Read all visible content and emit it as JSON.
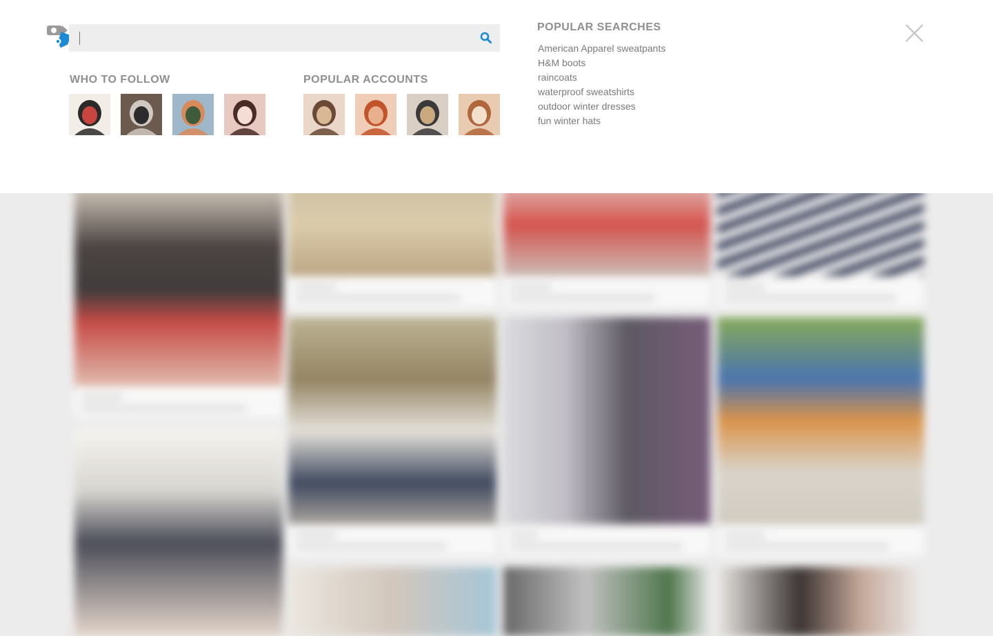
{
  "search": {
    "placeholder": "",
    "value": "",
    "icon": "search-icon",
    "accent": "#1d8ad6"
  },
  "who_to_follow": {
    "title": "WHO TO FOLLOW",
    "avatars": [
      {
        "name": "avatar-1",
        "colors": [
          "#f2ede6",
          "#2a2a2a",
          "#c9453f"
        ]
      },
      {
        "name": "avatar-2",
        "colors": [
          "#6b5a4d",
          "#cfc9c2",
          "#2c2c2c"
        ]
      },
      {
        "name": "avatar-3",
        "colors": [
          "#9fb8c9",
          "#d98a5c",
          "#3e5c3c"
        ]
      },
      {
        "name": "avatar-4",
        "colors": [
          "#e7c9c2",
          "#4a2b26",
          "#f4ddd4"
        ]
      }
    ]
  },
  "popular_accounts": {
    "title": "POPULAR ACCOUNTS",
    "avatars": [
      {
        "name": "avatar-5",
        "colors": [
          "#e9d8c9",
          "#6b4a35",
          "#d9b896"
        ]
      },
      {
        "name": "avatar-6",
        "colors": [
          "#f0cdb7",
          "#c2542c",
          "#e8b08c"
        ]
      },
      {
        "name": "avatar-7",
        "colors": [
          "#d9cfc4",
          "#3a3a3a",
          "#c9a97e"
        ]
      },
      {
        "name": "avatar-8",
        "colors": [
          "#e8cbb1",
          "#b0673c",
          "#f2e0cc"
        ]
      }
    ]
  },
  "popular_searches": {
    "title": "POPULAR SEARCHES",
    "items": [
      "American Apparel sweatpants",
      "H&M boots",
      "raincoats",
      "waterproof sweatshirts",
      "outdoor winter dresses",
      "fun winter hats"
    ]
  },
  "close": {
    "icon": "close-icon"
  },
  "logo": {
    "icon": "tag-logo-icon",
    "colors": [
      "#9a9a9a",
      "#1d8ad6"
    ]
  }
}
